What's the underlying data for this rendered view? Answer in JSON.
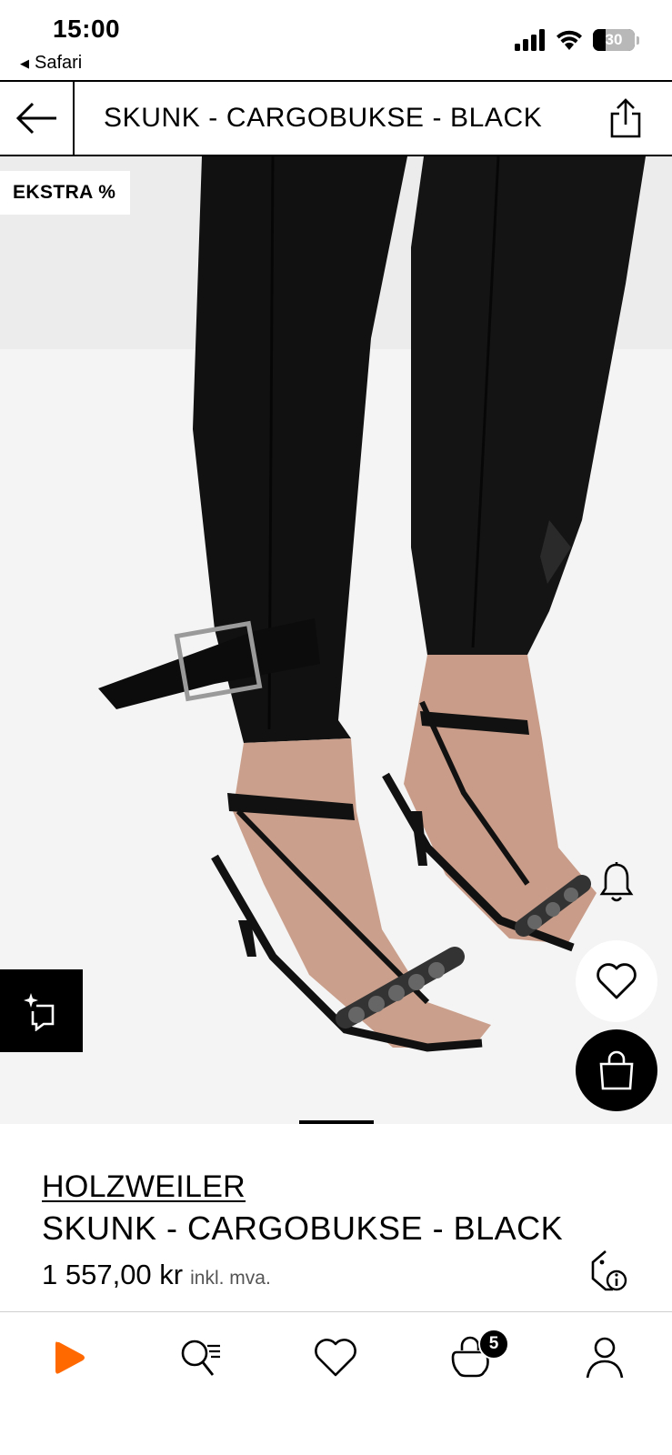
{
  "status_bar": {
    "time": "15:00",
    "back_app": "Safari",
    "battery": "30",
    "battery_level": 0.3
  },
  "header": {
    "title": "SKUNK - CARGOBUKSE - BLACK"
  },
  "gallery": {
    "badge": "EKSTRA %",
    "image_count": 3,
    "active_index": 1
  },
  "product": {
    "brand": "HOLZWEILER",
    "name": "SKUNK - CARGOBUKSE - BLACK",
    "price": "1 557,00 kr",
    "tax_note": "inkl. mva."
  },
  "bottom_nav": {
    "cart_count": "5",
    "items": [
      "home-icon",
      "search-icon",
      "wishlist-icon",
      "bag-icon",
      "profile-icon"
    ]
  },
  "colors": {
    "brand_accent": "#ff6900",
    "text": "#000000",
    "image_background": "#f1f1f1"
  }
}
